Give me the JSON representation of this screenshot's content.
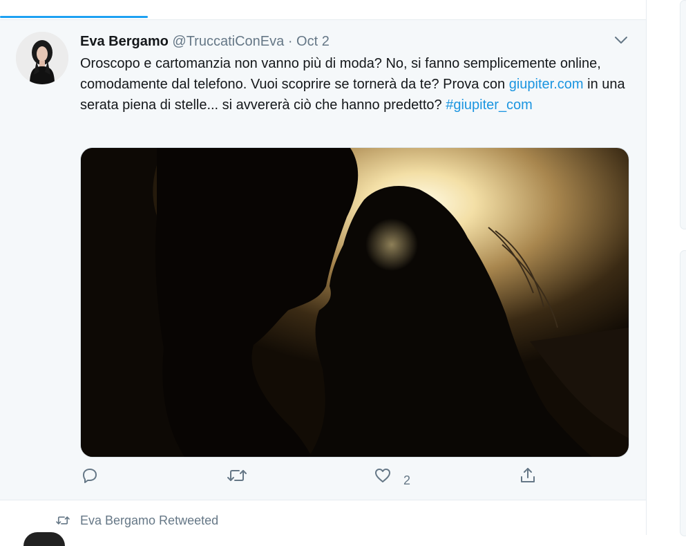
{
  "tweet": {
    "author_name": "Eva Bergamo",
    "author_handle": "@TruccatiConEva",
    "separator": "·",
    "date": "Oct 2",
    "text_part1": "Oroscopo e cartomanzia non vanno più di moda? No, si fanno semplicemente online, comodamente dal telefono. Vuoi scoprire se tornerà da te? Prova con ",
    "link_text": "giupiter.com",
    "text_part2": " in una serata piena di stelle... si avvererà ciò che hanno predetto? ",
    "hashtag": "#giupiter_com",
    "like_count": "2"
  },
  "retweet_note": {
    "label": "Eva Bergamo Retweeted"
  },
  "icons": {
    "menu": "chevron-down-icon",
    "reply": "reply-icon",
    "retweet": "retweet-icon",
    "like": "heart-icon",
    "share": "share-icon"
  },
  "colors": {
    "accent": "#1da1f2",
    "link": "#1b95e0",
    "secondary_text": "#657786",
    "background": "#f5f8fa"
  }
}
